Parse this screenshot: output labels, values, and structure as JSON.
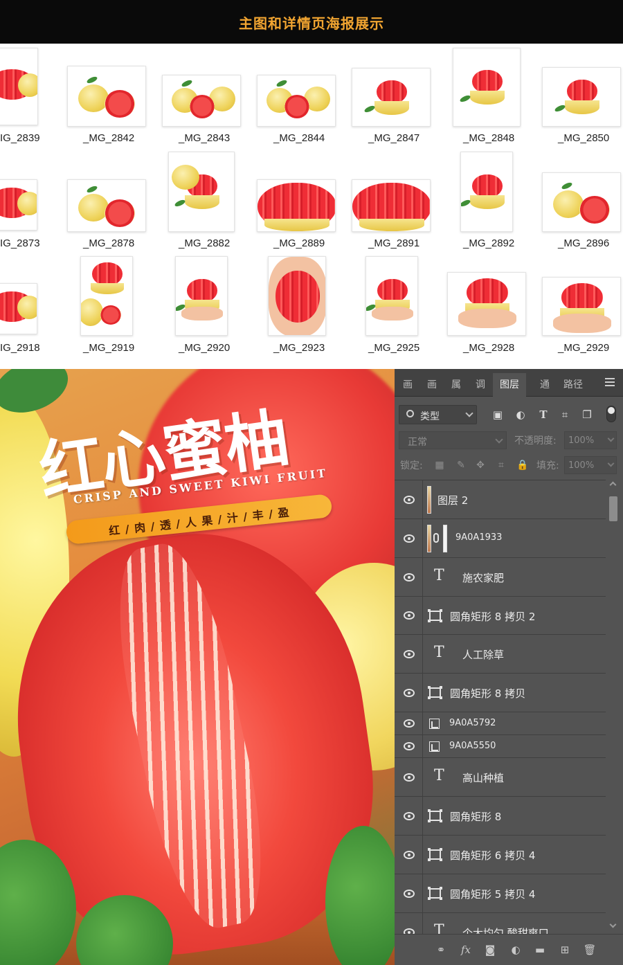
{
  "header": {
    "title": "主图和详情页海报展示"
  },
  "thumbnails": [
    {
      "label": "IG_2839"
    },
    {
      "label": "_MG_2842"
    },
    {
      "label": "_MG_2843"
    },
    {
      "label": "_MG_2844"
    },
    {
      "label": "_MG_2847"
    },
    {
      "label": "_MG_2848"
    },
    {
      "label": "_MG_2850"
    },
    {
      "label": "IG_2873"
    },
    {
      "label": "_MG_2878"
    },
    {
      "label": "_MG_2882"
    },
    {
      "label": "_MG_2889"
    },
    {
      "label": "_MG_2891"
    },
    {
      "label": "_MG_2892"
    },
    {
      "label": "_MG_2896"
    },
    {
      "label": "IG_2918"
    },
    {
      "label": "_MG_2919"
    },
    {
      "label": "_MG_2920"
    },
    {
      "label": "_MG_2923"
    },
    {
      "label": "_MG_2925"
    },
    {
      "label": "_MG_2928"
    },
    {
      "label": "_MG_2929"
    }
  ],
  "poster": {
    "title": "红心蜜柚",
    "subtitle": "CRISP AND SWEET KIWI FRUIT",
    "tagline": "红 / 肉 / 透 / 人   果 / 汁 / 丰 / 盈"
  },
  "photoshop": {
    "tabs": [
      "画",
      "画",
      "属",
      "调",
      "图层",
      "通",
      "路径"
    ],
    "active_tab": "图层",
    "filter_label": "类型",
    "blend_mode": "正常",
    "opacity_label": "不透明度:",
    "opacity_value": "100%",
    "lock_label": "锁定:",
    "fill_label": "填充:",
    "fill_value": "100%",
    "layers": [
      {
        "type": "pixel",
        "name": "图层 2"
      },
      {
        "type": "linked",
        "name": "9A0A1933"
      },
      {
        "type": "text",
        "name": "施农家肥"
      },
      {
        "type": "shape",
        "name": "圆角矩形 8 拷贝 2"
      },
      {
        "type": "text",
        "name": "人工除草"
      },
      {
        "type": "shape",
        "name": "圆角矩形 8 拷贝"
      },
      {
        "type": "smart",
        "name": "9A0A5792"
      },
      {
        "type": "smart",
        "name": "9A0A5550"
      },
      {
        "type": "text",
        "name": "高山种植"
      },
      {
        "type": "shape",
        "name": "圆角矩形 8"
      },
      {
        "type": "shape",
        "name": "圆角矩形 6 拷贝 4"
      },
      {
        "type": "shape",
        "name": "圆角矩形 5 拷贝 4"
      },
      {
        "type": "text",
        "name": "个大均匀 酸甜爽口",
        "more": "..."
      }
    ]
  },
  "colors": {
    "header_bg": "#0a0a0a",
    "header_text": "#f2a531",
    "ps_panel": "#535353",
    "pill": "#f49a1a"
  }
}
